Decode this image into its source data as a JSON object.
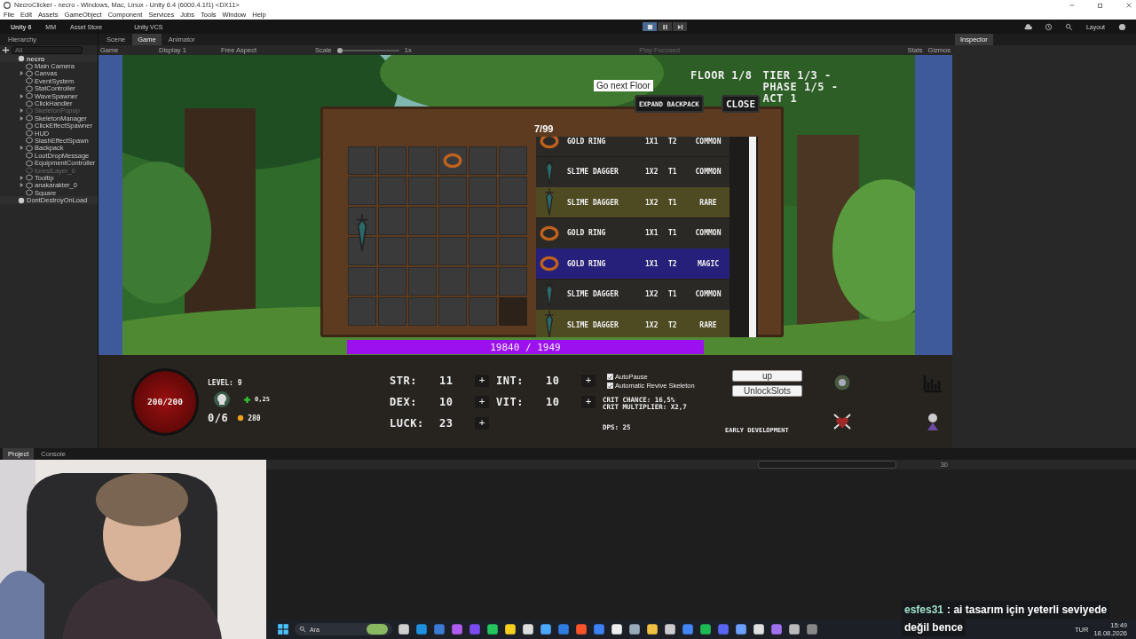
{
  "window": {
    "title": "NecroClicker - necro - Windows, Mac, Linux - Unity 6.4 (6000.4.1f1) <DX11>"
  },
  "menu": [
    "File",
    "Edit",
    "Assets",
    "GameObject",
    "Component",
    "Services",
    "Jobs",
    "Tools",
    "Window",
    "Help"
  ],
  "toolbar": {
    "account": "Unity 6",
    "user": "MM",
    "store": "Asset Store",
    "vcs": "Unity VCS",
    "layout": "Layout",
    "playing": true
  },
  "hierarchy": {
    "title": "Hierarchy",
    "search_placeholder": "All",
    "scene": "necro",
    "children": [
      {
        "name": "Main Camera",
        "expandable": false,
        "active": true
      },
      {
        "name": "Canvas",
        "expandable": true,
        "active": true
      },
      {
        "name": "EventSystem",
        "expandable": false,
        "active": true
      },
      {
        "name": "StatController",
        "expandable": false,
        "active": true
      },
      {
        "name": "WaveSpawner",
        "expandable": true,
        "active": true
      },
      {
        "name": "ClickHandler",
        "expandable": false,
        "active": true
      },
      {
        "name": "SkeletonPopup",
        "expandable": true,
        "active": false
      },
      {
        "name": "SkeletonManager",
        "expandable": true,
        "active": true
      },
      {
        "name": "ClickEffectSpawner",
        "expandable": false,
        "active": true
      },
      {
        "name": "HUD",
        "expandable": false,
        "active": true
      },
      {
        "name": "SlashEffectSpawn",
        "expandable": false,
        "active": true
      },
      {
        "name": "Backpack",
        "expandable": true,
        "active": true
      },
      {
        "name": "LootDropMessage",
        "expandable": false,
        "active": true
      },
      {
        "name": "EquipmentController",
        "expandable": false,
        "active": true
      },
      {
        "name": "forestLayer_0",
        "expandable": false,
        "active": false
      },
      {
        "name": "Tooltip",
        "expandable": true,
        "active": true
      },
      {
        "name": "anakarakter_0",
        "expandable": true,
        "active": true
      },
      {
        "name": "Square",
        "expandable": false,
        "active": true
      }
    ],
    "dont_destroy": "DontDestroyOnLoad"
  },
  "view_tabs": [
    {
      "label": "Scene",
      "selected": false
    },
    {
      "label": "Game",
      "selected": true
    },
    {
      "label": "Animator",
      "selected": false
    }
  ],
  "game_toolbar": {
    "mode": "Game",
    "display": "Display 1",
    "aspect": "Free Aspect",
    "scale_label": "Scale",
    "scale_value": "1x",
    "scale_slider": {
      "level": 0
    },
    "play_mode": "Play Focused",
    "stats": "Stats",
    "gizmos": "Gizmos"
  },
  "game": {
    "floor": "FLOOR 1/8",
    "tier": "TIER 1/3  -",
    "phase": "PHASE 1/5  -",
    "act": "ACT 1",
    "next_floor": "Go next Floor",
    "expand": "EXPAND BACKPACK",
    "close": "CLOSE",
    "count": "7/99",
    "grid": [
      [
        {
          "kind": "empty"
        },
        {
          "kind": "empty"
        },
        {
          "kind": "empty"
        },
        {
          "kind": "ring"
        },
        {
          "kind": "empty"
        },
        {
          "kind": "empty"
        }
      ],
      [
        {
          "kind": "empty"
        },
        {
          "kind": "empty"
        },
        {
          "kind": "empty"
        },
        {
          "kind": "empty"
        },
        {
          "kind": "empty"
        },
        {
          "kind": "empty"
        }
      ],
      [
        {
          "kind": "dagger"
        },
        {
          "kind": "empty"
        },
        {
          "kind": "empty"
        },
        {
          "kind": "empty"
        },
        {
          "kind": "empty"
        },
        {
          "kind": "empty"
        }
      ],
      [
        {
          "kind": "empty"
        },
        {
          "kind": "empty"
        },
        {
          "kind": "empty"
        },
        {
          "kind": "empty"
        },
        {
          "kind": "empty"
        },
        {
          "kind": "empty"
        }
      ],
      [
        {
          "kind": "empty"
        },
        {
          "kind": "empty"
        },
        {
          "kind": "empty"
        },
        {
          "kind": "empty"
        },
        {
          "kind": "empty"
        },
        {
          "kind": "empty"
        }
      ],
      [
        {
          "kind": "empty"
        },
        {
          "kind": "empty"
        },
        {
          "kind": "empty"
        },
        {
          "kind": "empty"
        },
        {
          "kind": "empty"
        },
        {
          "kind": "locked"
        }
      ]
    ],
    "items": [
      {
        "kind": "ring",
        "name": "GOLD RING",
        "size": "1X1",
        "tier": "T2",
        "rarity": "COMMON",
        "color": "#2b2926"
      },
      {
        "kind": "dagger",
        "name": "SLIME DAGGER",
        "size": "1X2",
        "tier": "T1",
        "rarity": "COMMON",
        "color": "#2b2926"
      },
      {
        "kind": "dagger",
        "name": "SLIME DAGGER",
        "size": "1X2",
        "tier": "T1",
        "rarity": "RARE",
        "color": "#4e4a22"
      },
      {
        "kind": "ring",
        "name": "GOLD RING",
        "size": "1X1",
        "tier": "T1",
        "rarity": "COMMON",
        "color": "#2b2926"
      },
      {
        "kind": "ring",
        "name": "GOLD RING",
        "size": "1X1",
        "tier": "T2",
        "rarity": "MAGIC",
        "color": "#26207a"
      },
      {
        "kind": "dagger",
        "name": "SLIME DAGGER",
        "size": "1X2",
        "tier": "T1",
        "rarity": "COMMON",
        "color": "#2b2926"
      },
      {
        "kind": "dagger",
        "name": "SLIME DAGGER",
        "size": "1X2",
        "tier": "T2",
        "rarity": "RARE",
        "color": "#4e4a22"
      }
    ],
    "xp": "19840 / 1949"
  },
  "hud": {
    "health": "200/200",
    "level": "LEVEL: 9",
    "skeletons": "0/6",
    "rate": "0,25",
    "gold": "280",
    "stats": [
      {
        "label": "STR:",
        "value": "11",
        "add": "+"
      },
      {
        "label": "INT:",
        "value": "10",
        "add": "+"
      },
      {
        "label": "DEX:",
        "value": "10",
        "add": "+"
      },
      {
        "label": "VIT:",
        "value": "10",
        "add": "+"
      },
      {
        "label": "LUCK:",
        "value": "23",
        "add": "+"
      }
    ],
    "options": [
      {
        "label": "AutoPause",
        "checked": true
      },
      {
        "label": "Automatic Revive Skeleton",
        "checked": true
      }
    ],
    "crit_chance": "CRIT CHANCE: 16,5%",
    "crit_multiplier": "CRIT MULTIPLIER: X2,7",
    "dps": "DPS: 25",
    "buttons": [
      "up",
      "UnlockSlots"
    ],
    "note": "EARLY DEVELOPMENT"
  },
  "inspector": {
    "title": "Inspector"
  },
  "bottom_panel": {
    "tabs": [
      {
        "label": "Project",
        "selected": true
      },
      {
        "label": "Console",
        "selected": false
      }
    ],
    "count": "30"
  },
  "chat": {
    "user": "esfes31",
    "lines": [
      ": ai tasarım için yeterli seviyede",
      "değil bence"
    ]
  },
  "taskbar": {
    "search": "Ara",
    "apps": [
      {
        "color": "#cfcfcf"
      },
      {
        "color": "#1e90e0"
      },
      {
        "color": "#3a7bd5"
      },
      {
        "color": "#b05cf0"
      },
      {
        "color": "#7a4cf0"
      },
      {
        "color": "#22c55e"
      },
      {
        "color": "#f5d020"
      },
      {
        "color": "#dddddd"
      },
      {
        "color": "#4aa8ff"
      },
      {
        "color": "#2f7de1"
      },
      {
        "color": "#fb542b"
      },
      {
        "color": "#3b82f6"
      },
      {
        "color": "#eeeeee"
      },
      {
        "color": "#99aabb"
      },
      {
        "color": "#f0c040"
      },
      {
        "color": "#cccccc"
      },
      {
        "color": "#4285f4"
      },
      {
        "color": "#1db954"
      },
      {
        "color": "#5865f2"
      },
      {
        "color": "#6aa0ff"
      },
      {
        "color": "#e0e0e0"
      },
      {
        "color": "#a070f0"
      },
      {
        "color": "#bbbbbb"
      },
      {
        "color": "#888888"
      }
    ],
    "language": "TUR",
    "time": "15:49",
    "date": "18.08.2026"
  }
}
